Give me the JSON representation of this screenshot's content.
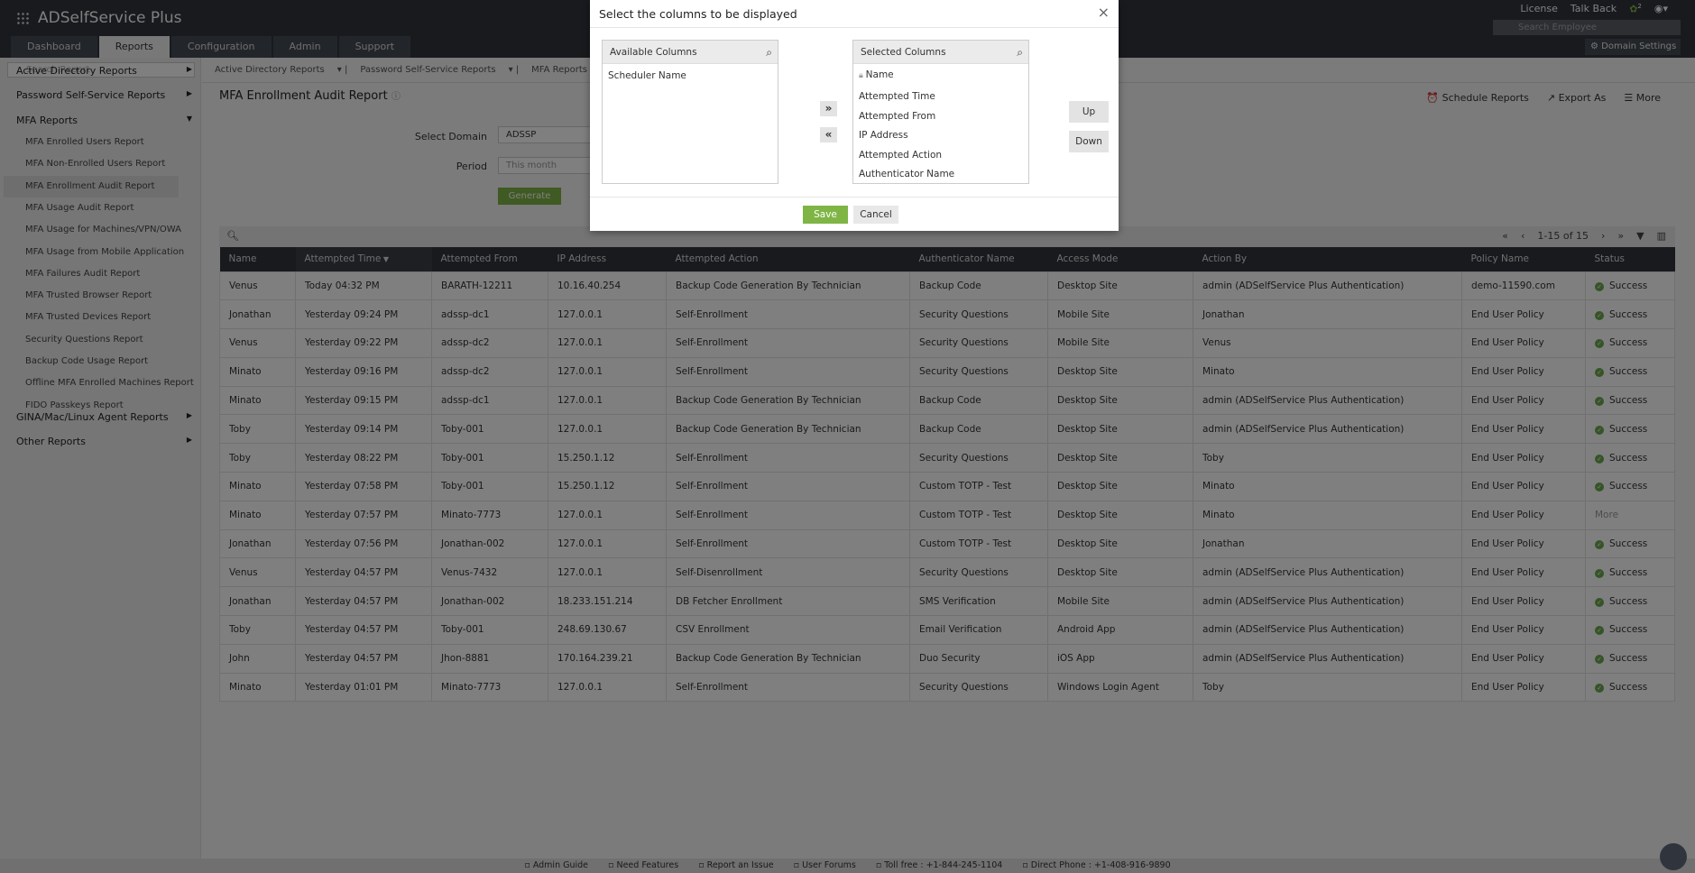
{
  "app": {
    "title": "ADSelfService Plus"
  },
  "header": {
    "tabs": [
      "Dashboard",
      "Reports",
      "Configuration",
      "Admin",
      "Support"
    ],
    "license": "License",
    "talk_back": "Talk Back",
    "notif_count": "2",
    "search_placeholder": "Search Employee",
    "domain_settings": "Domain Settings"
  },
  "sidebar": {
    "search_placeholder": "Search Report",
    "groups": [
      "Active Directory Reports",
      "Password Self-Service Reports",
      "MFA Reports",
      "GINA/Mac/Linux Agent Reports",
      "Other Reports"
    ],
    "mfa_items": [
      "MFA Enrolled Users Report",
      "MFA Non-Enrolled Users Report",
      "MFA Enrollment Audit Report",
      "MFA Usage Audit Report",
      "MFA Usage for Machines/VPN/OWA",
      "MFA Usage from Mobile Application",
      "MFA Failures Audit Report",
      "MFA Trusted Browser Report",
      "MFA Trusted Devices Report",
      "Security Questions Report",
      "Backup Code Usage Report",
      "Offline MFA Enrolled Machines Report",
      "FIDO Passkeys Report"
    ]
  },
  "subnav": [
    "Active Directory Reports",
    "Password Self-Service Reports",
    "MFA Reports"
  ],
  "report": {
    "title": "MFA Enrollment Audit Report",
    "actions": [
      "Schedule Reports",
      "Export As",
      "More"
    ],
    "domain_label": "Select Domain",
    "domain_value": "ADSSP",
    "period_label": "Period",
    "period_value": "This month",
    "generate": "Generate",
    "pager": "1-15 of 15"
  },
  "table": {
    "columns": [
      "Name",
      "Attempted Time",
      "Attempted From",
      "IP Address",
      "Attempted Action",
      "Authenticator Name",
      "Access Mode",
      "Action By",
      "Policy Name",
      "Status"
    ],
    "rows": [
      [
        "Venus",
        "Today 04:32 PM",
        "BARATH-12211",
        "10.16.40.254",
        "Backup Code Generation By Technician",
        "Backup Code",
        "Desktop Site",
        "admin (ADSelfService Plus Authentication)",
        "demo-11590.com",
        "Success"
      ],
      [
        "Jonathan",
        "Yesterday 09:24 PM",
        "adssp-dc1",
        "127.0.0.1",
        "Self-Enrollment",
        "Security Questions",
        "Mobile Site",
        "Jonathan",
        "End User Policy",
        "Success"
      ],
      [
        "Venus",
        "Yesterday 09:22 PM",
        "adssp-dc2",
        "127.0.0.1",
        "Self-Enrollment",
        "Security Questions",
        "Mobile Site",
        "Venus",
        "End User Policy",
        "Success"
      ],
      [
        "Minato",
        "Yesterday 09:16 PM",
        "adssp-dc2",
        "127.0.0.1",
        "Self-Enrollment",
        "Security Questions",
        "Desktop Site",
        "Minato",
        "End User Policy",
        "Success"
      ],
      [
        "Minato",
        "Yesterday 09:15 PM",
        "adssp-dc1",
        "127.0.0.1",
        "Backup Code Generation By Technician",
        "Backup Code",
        "Desktop Site",
        "admin (ADSelfService Plus Authentication)",
        "End User Policy",
        "Success"
      ],
      [
        "Toby",
        "Yesterday 09:14 PM",
        "Toby-001",
        "127.0.0.1",
        "Backup Code Generation By Technician",
        "Backup Code",
        "Desktop Site",
        "admin (ADSelfService Plus Authentication)",
        "End User Policy",
        "Success"
      ],
      [
        "Toby",
        "Yesterday 08:22 PM",
        "Toby-001",
        "15.250.1.12",
        "Self-Enrollment",
        "Security Questions",
        "Desktop Site",
        "Toby",
        "End User Policy",
        "Success"
      ],
      [
        "Minato",
        "Yesterday 07:58 PM",
        "Toby-001",
        "15.250.1.12",
        "Self-Enrollment",
        "Custom TOTP - Test",
        "Desktop Site",
        "Minato",
        "End User Policy",
        "Success"
      ],
      [
        "Minato",
        "Yesterday 07:57 PM",
        "Minato-7773",
        "127.0.0.1",
        "Self-Enrollment",
        "Custom TOTP - Test",
        "Desktop Site",
        "Minato",
        "End User Policy",
        "More"
      ],
      [
        "Jonathan",
        "Yesterday 07:56 PM",
        "Jonathan-002",
        "127.0.0.1",
        "Self-Enrollment",
        "Custom TOTP - Test",
        "Desktop Site",
        "Jonathan",
        "End User Policy",
        "Success"
      ],
      [
        "Venus",
        "Yesterday 04:57 PM",
        "Venus-7432",
        "127.0.0.1",
        "Self-Disenrollment",
        "Security Questions",
        "Desktop Site",
        "admin (ADSelfService Plus Authentication)",
        "End User Policy",
        "Success"
      ],
      [
        "Jonathan",
        "Yesterday 04:57 PM",
        "Jonathan-002",
        "18.233.151.214",
        "DB Fetcher Enrollment",
        "SMS Verification",
        "Mobile Site",
        "admin (ADSelfService Plus Authentication)",
        "End User Policy",
        "Success"
      ],
      [
        "Toby",
        "Yesterday 04:57 PM",
        "Toby-001",
        "248.69.130.67",
        "CSV Enrollment",
        "Email Verification",
        "Android App",
        "admin (ADSelfService Plus Authentication)",
        "End User Policy",
        "Success"
      ],
      [
        "John",
        "Yesterday 04:57 PM",
        "Jhon-8881",
        "170.164.239.21",
        "Backup Code Generation By Technician",
        "Duo Security",
        "iOS App",
        "admin (ADSelfService Plus Authentication)",
        "End User Policy",
        "Success"
      ],
      [
        "Minato",
        "Yesterday 01:01 PM",
        "Minato-7773",
        "127.0.0.1",
        "Self-Enrollment",
        "Security Questions",
        "Windows Login Agent",
        "Toby",
        "End User Policy",
        "Success"
      ]
    ]
  },
  "footer": [
    "Admin Guide",
    "Need Features",
    "Report an Issue",
    "User Forums",
    "Toll free : +1-844-245-1104",
    "Direct Phone : +1-408-916-9890"
  ],
  "dialog": {
    "title": "Select the columns to be displayed",
    "available_header": "Available Columns",
    "available": [
      "Scheduler Name"
    ],
    "selected_header": "Selected Columns",
    "selected": [
      "Name",
      "Attempted Time",
      "Attempted From",
      "IP Address",
      "Attempted Action",
      "Authenticator Name"
    ],
    "add": "»",
    "remove": "«",
    "up": "Up",
    "down": "Down",
    "save": "Save",
    "cancel": "Cancel",
    "close": "×"
  },
  "colors": {
    "accent": "#7fb545",
    "header": "#30353d"
  }
}
